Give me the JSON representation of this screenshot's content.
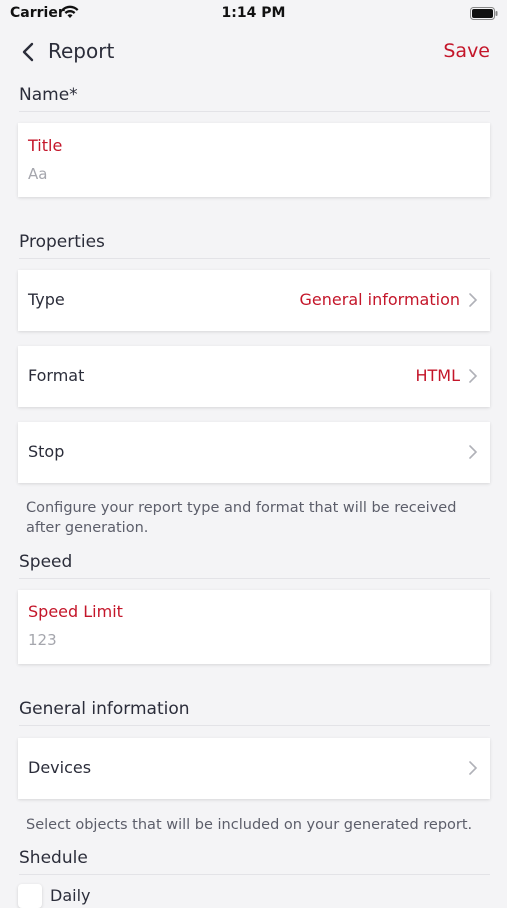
{
  "status_bar": {
    "carrier": "Carrier",
    "time": "1:14 PM"
  },
  "nav": {
    "title": "Report",
    "save_label": "Save"
  },
  "name_section": {
    "heading": "Name*",
    "title_label": "Title",
    "title_placeholder": "Aa"
  },
  "properties": {
    "heading": "Properties",
    "rows": [
      {
        "label": "Type",
        "value": "General information"
      },
      {
        "label": "Format",
        "value": "HTML"
      },
      {
        "label": "Stop",
        "value": ""
      }
    ],
    "note": "Configure your report type and format that will be received after generation."
  },
  "speed": {
    "heading": "Speed",
    "limit_label": "Speed Limit",
    "limit_placeholder": "123"
  },
  "general": {
    "heading": "General information",
    "devices_label": "Devices",
    "note": "Select objects that will be included on your generated report."
  },
  "schedule": {
    "heading": "Shedule",
    "daily_label": "Daily"
  },
  "colors": {
    "accent": "#c4162a",
    "background": "#f4f4f6",
    "text": "#2b2d3a"
  }
}
